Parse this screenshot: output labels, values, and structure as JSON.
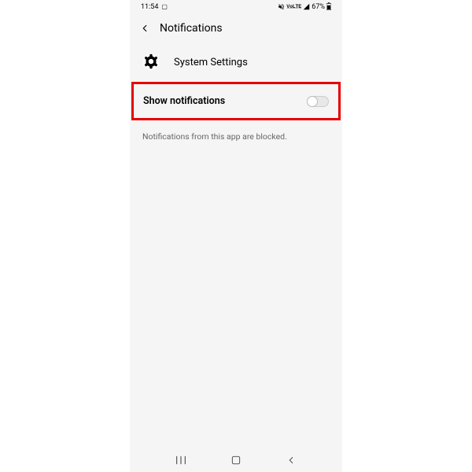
{
  "status_bar": {
    "time": "11:54",
    "battery": "67%"
  },
  "header": {
    "title": "Notifications"
  },
  "app": {
    "name": "System Settings"
  },
  "toggle": {
    "label": "Show notifications",
    "state": "off"
  },
  "blocked_message": "Notifications from this app are blocked."
}
